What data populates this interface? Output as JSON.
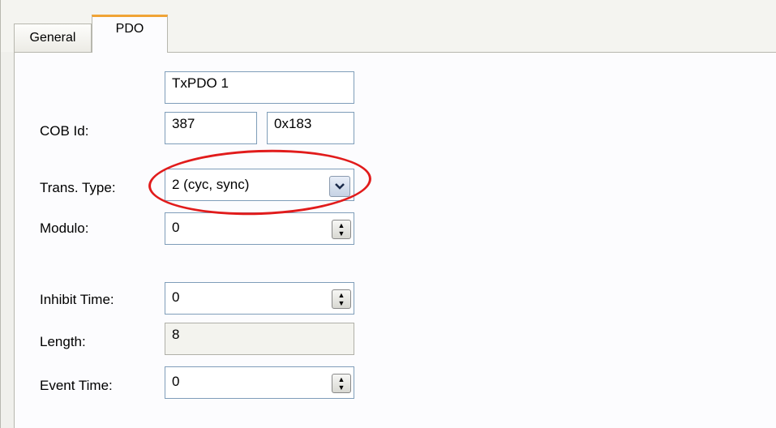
{
  "tabs": [
    {
      "label": "General"
    },
    {
      "label": "PDO"
    }
  ],
  "form": {
    "name_value": "TxPDO 1",
    "cob_label": "COB Id:",
    "cob_decimal": "387",
    "cob_hex": "0x183",
    "trans_label": "Trans. Type:",
    "trans_value": "2 (cyc, sync)",
    "modulo_label": "Modulo:",
    "modulo_value": "0",
    "inhibit_label": "Inhibit Time:",
    "inhibit_value": "0",
    "length_label": "Length:",
    "length_value": "8",
    "event_label": "Event Time:",
    "event_value": "0"
  },
  "icons": {
    "dropdown": "chevron-down-icon",
    "spinner": "spin-updown-icon"
  },
  "colors": {
    "highlight_ellipse": "#e11b1b",
    "active_tab_accent": "#f0a436",
    "input_border": "#7f9db9"
  }
}
